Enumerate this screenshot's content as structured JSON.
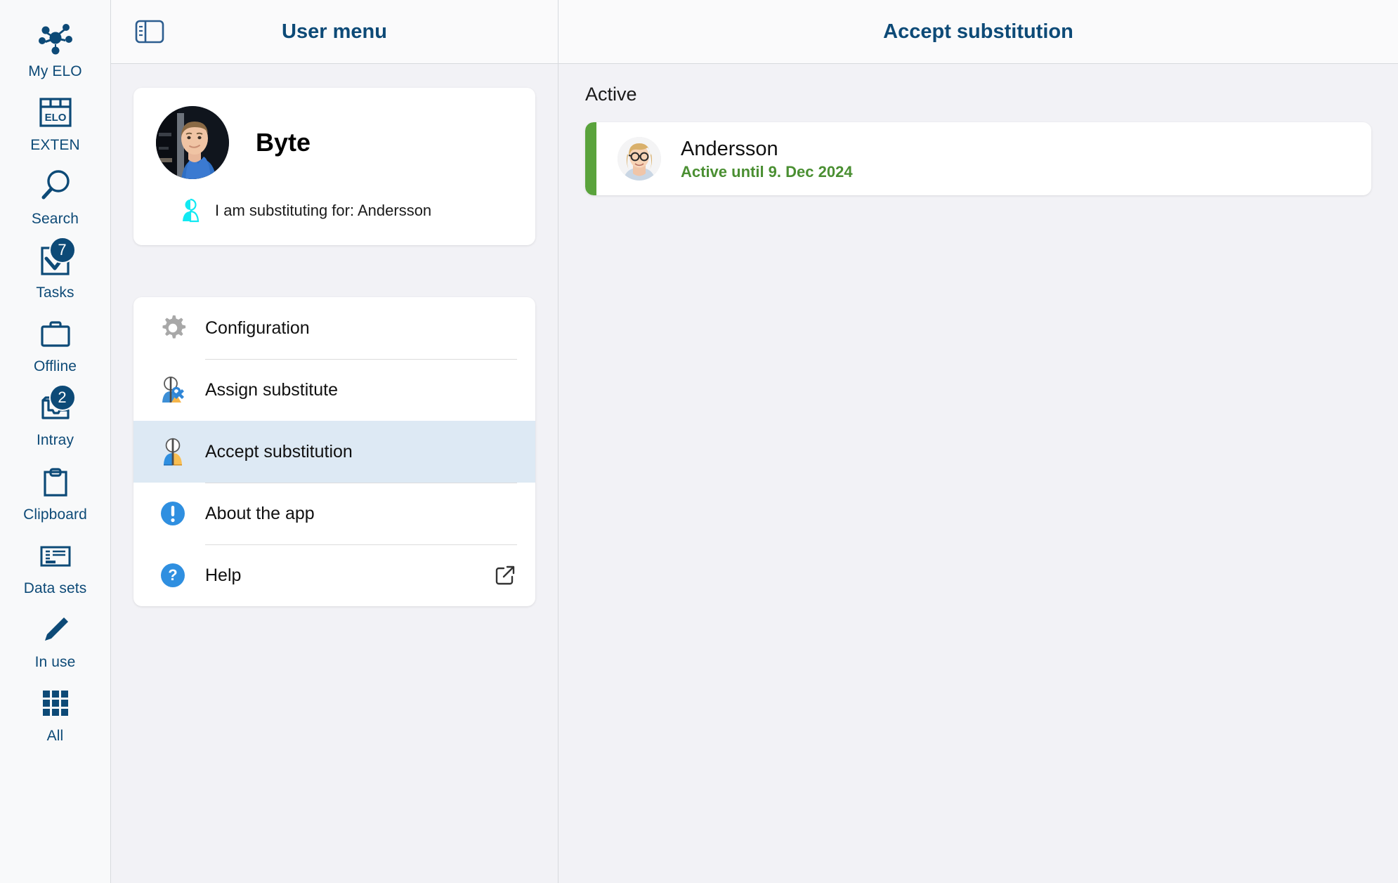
{
  "rail": {
    "items": [
      {
        "label": "My ELO",
        "icon": "network-hub-icon",
        "badge": null
      },
      {
        "label": "EXTEN",
        "icon": "elo-archive-icon",
        "badge": null
      },
      {
        "label": "Search",
        "icon": "search-icon",
        "badge": null
      },
      {
        "label": "Tasks",
        "icon": "tasks-check-icon",
        "badge": "7"
      },
      {
        "label": "Offline",
        "icon": "briefcase-icon",
        "badge": null
      },
      {
        "label": "Intray",
        "icon": "intray-tray-icon",
        "badge": "2"
      },
      {
        "label": "Clipboard",
        "icon": "clipboard-icon",
        "badge": null
      },
      {
        "label": "Data sets",
        "icon": "data-sets-icon",
        "badge": null
      },
      {
        "label": "In use",
        "icon": "pencil-icon",
        "badge": null
      },
      {
        "label": "All",
        "icon": "grid-apps-icon",
        "badge": null
      }
    ]
  },
  "middle": {
    "header": {
      "title": "User menu",
      "toggle_icon": "panel-toggle-icon"
    },
    "profile": {
      "name": "Byte",
      "substitution_note": "I am substituting for: Andersson",
      "substitution_icon": "substitute-person-icon",
      "avatar": "avatar-byte"
    },
    "menu": [
      {
        "label": "Configuration",
        "icon": "gear-icon",
        "selected": false,
        "external": false
      },
      {
        "label": "Assign substitute",
        "icon": "assign-substitute-icon",
        "selected": false,
        "external": false
      },
      {
        "label": "Accept substitution",
        "icon": "accept-substitution-icon",
        "selected": true,
        "external": false
      },
      {
        "label": "About the app",
        "icon": "info-exclamation-icon",
        "selected": false,
        "external": false
      },
      {
        "label": "Help",
        "icon": "help-question-icon",
        "selected": false,
        "external": true,
        "external_icon": "external-link-icon"
      }
    ]
  },
  "right": {
    "header": {
      "title": "Accept substitution"
    },
    "section_title": "Active",
    "substitutions": [
      {
        "name": "Andersson",
        "status": "Active until 9. Dec 2024",
        "avatar": "avatar-andersson"
      }
    ]
  },
  "colors": {
    "brand_navy": "#0d4a77",
    "selected_row": "#dde9f4",
    "active_green": "#5aa33c",
    "status_green": "#4a8f32",
    "badge_navy": "#0d4a77"
  }
}
